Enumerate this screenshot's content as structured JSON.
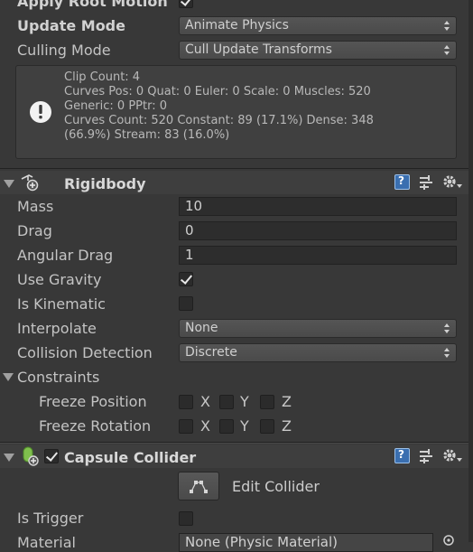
{
  "animator": {
    "apply_root_motion_label": "Apply Root Motion",
    "apply_root_motion_checked": true,
    "update_mode_label": "Update Mode",
    "update_mode_value": "Animate Physics",
    "culling_mode_label": "Culling Mode",
    "culling_mode_value": "Cull Update Transforms",
    "info_lines": [
      "Clip Count: 4",
      "Curves Pos: 0 Quat: 0 Euler: 0 Scale: 0 Muscles: 520",
      "Generic: 0 PPtr: 0",
      "Curves Count: 520 Constant: 89 (17.1%) Dense: 348",
      "(66.9%) Stream: 83 (16.0%)"
    ]
  },
  "rigidbody": {
    "title": "Rigidbody",
    "mass_label": "Mass",
    "mass_value": "10",
    "drag_label": "Drag",
    "drag_value": "0",
    "angular_drag_label": "Angular Drag",
    "angular_drag_value": "1",
    "use_gravity_label": "Use Gravity",
    "use_gravity_checked": true,
    "is_kinematic_label": "Is Kinematic",
    "is_kinematic_checked": false,
    "interpolate_label": "Interpolate",
    "interpolate_value": "None",
    "collision_detection_label": "Collision Detection",
    "collision_detection_value": "Discrete",
    "constraints_label": "Constraints",
    "freeze_position_label": "Freeze Position",
    "freeze_rotation_label": "Freeze Rotation",
    "axis_x": "X",
    "axis_y": "Y",
    "axis_z": "Z"
  },
  "capsule_collider": {
    "title": "Capsule Collider",
    "enabled": true,
    "edit_collider_label": "Edit Collider",
    "is_trigger_label": "Is Trigger",
    "is_trigger_checked": false,
    "material_label": "Material",
    "material_value": "None (Physic Material)"
  },
  "colors": {
    "background": "#383838",
    "field": "#2d2d2d",
    "help_icon": "#3a6fb0"
  }
}
